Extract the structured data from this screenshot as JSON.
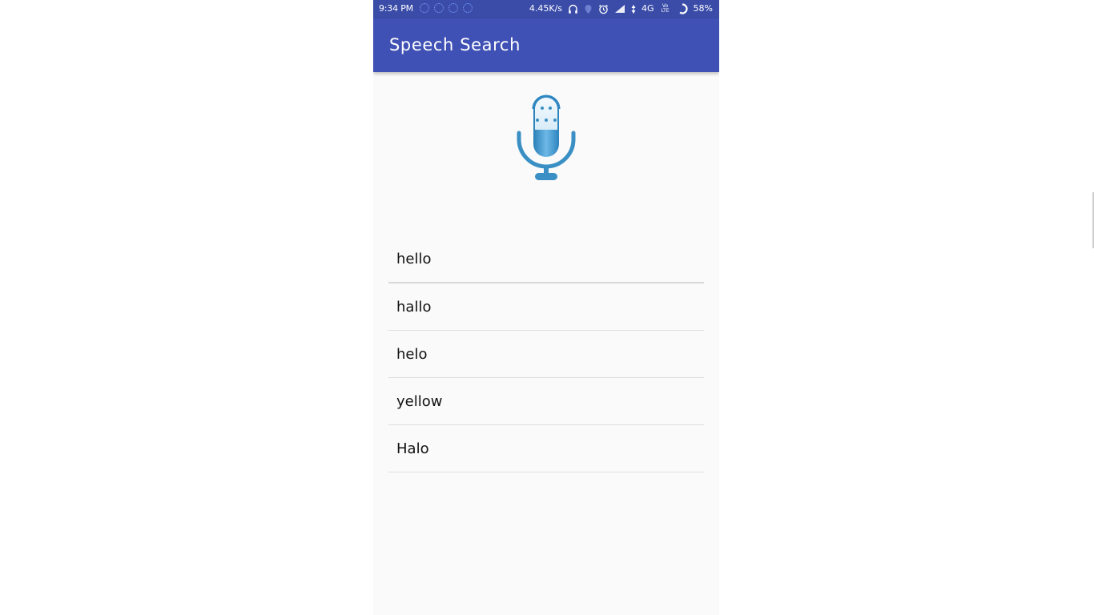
{
  "status_bar": {
    "time": "9:34 PM",
    "network_speed": "4.45K/s",
    "network_type": "4G",
    "volte": "Vo LTE",
    "battery": "58%",
    "icons": [
      "notification-icon",
      "notification-icon",
      "notification-icon",
      "notification-icon",
      "headphones-icon",
      "location-icon",
      "alarm-icon",
      "signal-icon",
      "data-arrows-icon",
      "volte-icon",
      "battery-icon"
    ]
  },
  "app_bar": {
    "title": "Speech Search"
  },
  "mic": {
    "icon": "microphone-icon",
    "color": "#3a8fc4"
  },
  "results": [
    "hello",
    "hallo",
    "helo",
    "yellow",
    "Halo"
  ],
  "colors": {
    "primary": "#3f51b5",
    "status_bar": "#3a4ca8",
    "background": "#fafafa"
  }
}
